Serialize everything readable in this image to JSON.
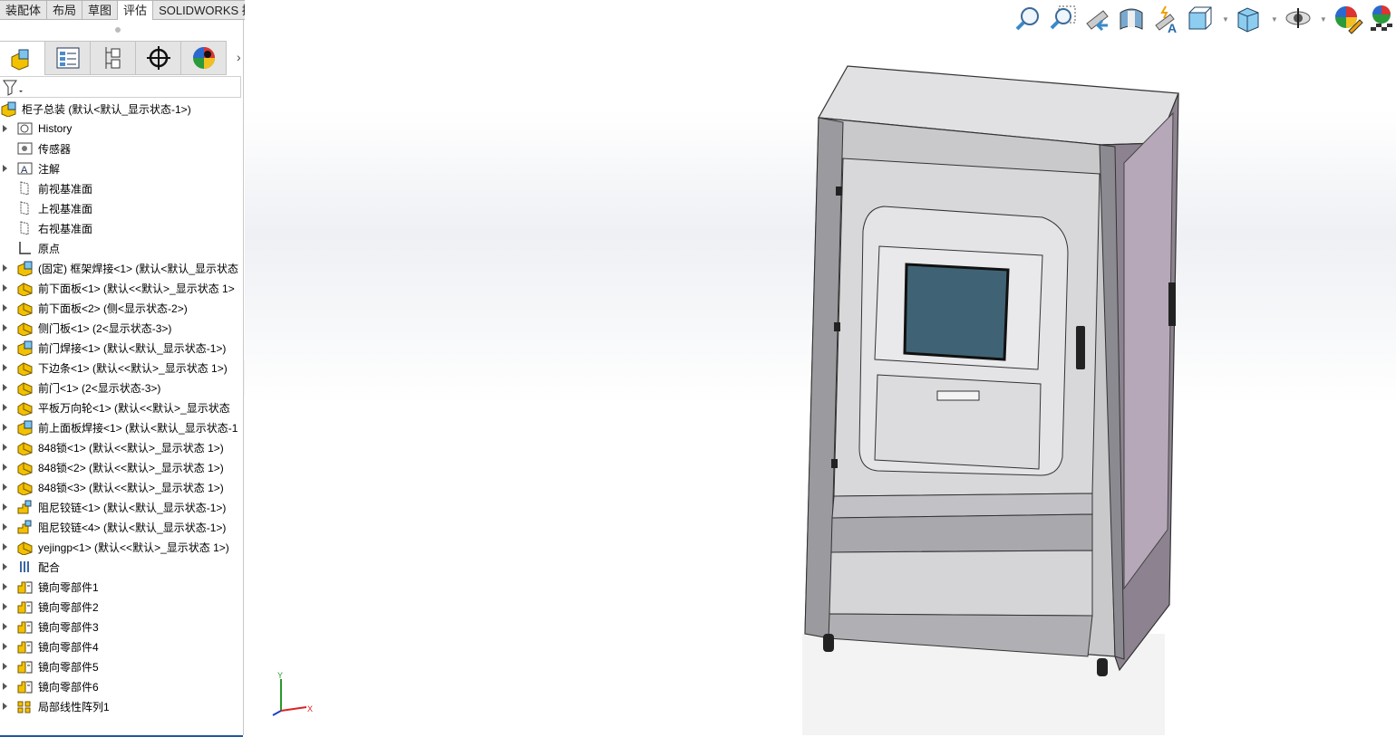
{
  "command_tabs": [
    "装配体",
    "布局",
    "草图",
    "评估",
    "SOLIDWORKS 插件"
  ],
  "active_tab": "评估",
  "panel_tabs": [
    {
      "icon": "feature-manager-icon"
    },
    {
      "icon": "property-manager-icon"
    },
    {
      "icon": "configuration-manager-icon"
    },
    {
      "icon": "dimxpert-icon"
    },
    {
      "icon": "display-manager-icon"
    }
  ],
  "tree": {
    "root": "柜子总装  (默认<默认_显示状态-1>)",
    "items": [
      {
        "label": "History",
        "icon": "history-icon",
        "arrow": true
      },
      {
        "label": "传感器",
        "icon": "sensor-icon",
        "arrow": false
      },
      {
        "label": "注解",
        "icon": "annotation-icon",
        "arrow": true
      },
      {
        "label": "前视基准面",
        "icon": "plane-icon",
        "arrow": false
      },
      {
        "label": "上视基准面",
        "icon": "plane-icon",
        "arrow": false
      },
      {
        "label": "右视基准面",
        "icon": "plane-icon",
        "arrow": false
      },
      {
        "label": "原点",
        "icon": "origin-icon",
        "arrow": false
      },
      {
        "label": "(固定) 框架焊接<1> (默认<默认_显示状态",
        "icon": "subassembly-icon",
        "arrow": true
      },
      {
        "label": "前下面板<1> (默认<<默认>_显示状态 1>",
        "icon": "part-icon",
        "arrow": true
      },
      {
        "label": "前下面板<2> (侧<显示状态-2>)",
        "icon": "part-icon",
        "arrow": true
      },
      {
        "label": "侧门板<1> (2<显示状态-3>)",
        "icon": "part-icon",
        "arrow": true
      },
      {
        "label": "前门焊接<1> (默认<默认_显示状态-1>)",
        "icon": "subassembly-icon",
        "arrow": true
      },
      {
        "label": "下边条<1> (默认<<默认>_显示状态 1>)",
        "icon": "part-icon",
        "arrow": true
      },
      {
        "label": "前门<1> (2<显示状态-3>)",
        "icon": "part-icon",
        "arrow": true
      },
      {
        "label": "平板万向轮<1> (默认<<默认>_显示状态",
        "icon": "part-icon",
        "arrow": true
      },
      {
        "label": "前上面板焊接<1> (默认<默认_显示状态-1",
        "icon": "subassembly-icon",
        "arrow": true
      },
      {
        "label": "848锁<1> (默认<<默认>_显示状态 1>)",
        "icon": "part-icon",
        "arrow": true
      },
      {
        "label": "848锁<2> (默认<<默认>_显示状态 1>)",
        "icon": "part-icon",
        "arrow": true
      },
      {
        "label": "848锁<3> (默认<<默认>_显示状态 1>)",
        "icon": "part-icon",
        "arrow": true
      },
      {
        "label": "阻尼铰链<1> (默认<默认_显示状态-1>)",
        "icon": "flexible-subassembly-icon",
        "arrow": true
      },
      {
        "label": "阻尼铰链<4> (默认<默认_显示状态-1>)",
        "icon": "flexible-subassembly-icon",
        "arrow": true
      },
      {
        "label": "yejingp<1> (默认<<默认>_显示状态 1>)",
        "icon": "part-icon",
        "arrow": true
      },
      {
        "label": "配合",
        "icon": "mates-icon",
        "arrow": true
      },
      {
        "label": "镜向零部件1",
        "icon": "mirror-component-icon",
        "arrow": true
      },
      {
        "label": "镜向零部件2",
        "icon": "mirror-component-icon",
        "arrow": true
      },
      {
        "label": "镜向零部件3",
        "icon": "mirror-component-icon",
        "arrow": true
      },
      {
        "label": "镜向零部件4",
        "icon": "mirror-component-icon",
        "arrow": true
      },
      {
        "label": "镜向零部件5",
        "icon": "mirror-component-icon",
        "arrow": true
      },
      {
        "label": "镜向零部件6",
        "icon": "mirror-component-icon",
        "arrow": true
      },
      {
        "label": "局部线性阵列1",
        "icon": "linear-pattern-icon",
        "arrow": true
      }
    ]
  },
  "heads_up_toolbar": [
    "zoom-to-fit-icon",
    "zoom-to-area-icon",
    "previous-view-icon",
    "section-view-icon",
    "dynamic-annotation-views-icon",
    "view-orientation-icon",
    "display-style-icon",
    "hide-show-items-icon",
    "edit-appearance-icon",
    "apply-scene-icon",
    "view-settings-icon"
  ],
  "triad": {
    "x": "X",
    "y": "Y"
  },
  "colors": {
    "accent": "#1e5aa0",
    "cabinet": "#cfcfd2",
    "side": "#8a7f8c",
    "screen": "#3f6375"
  }
}
